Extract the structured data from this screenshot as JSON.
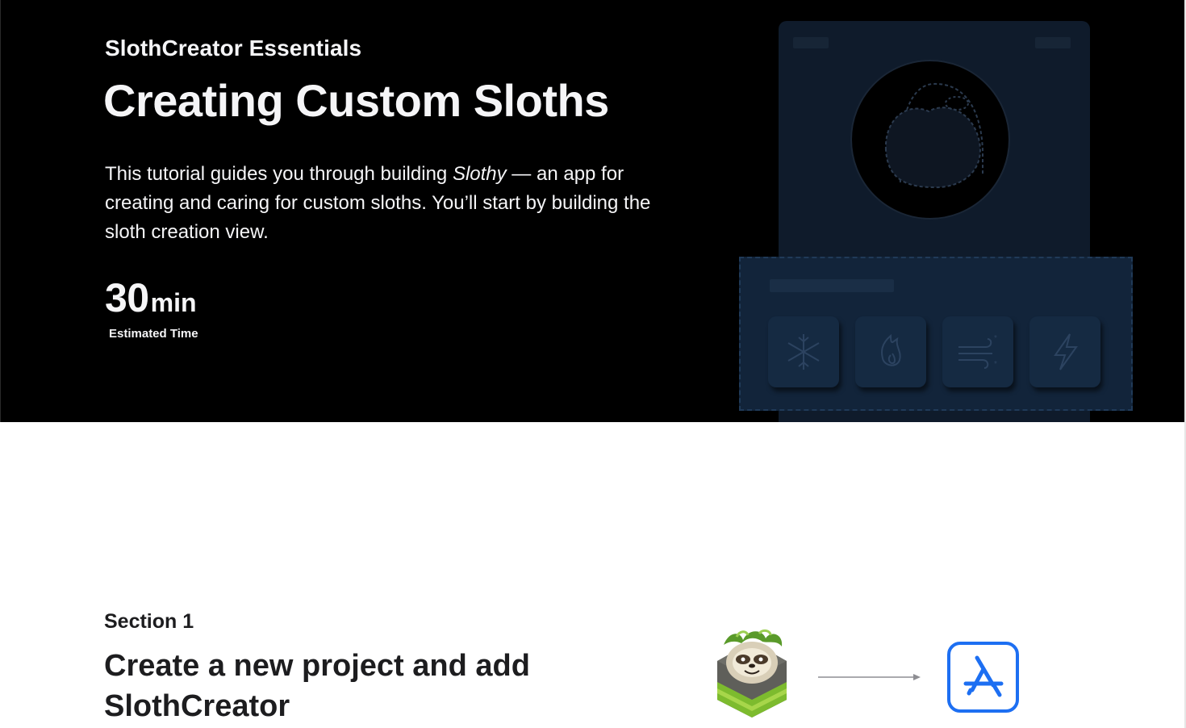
{
  "hero": {
    "eyebrow": "SlothCreator Essentials",
    "title": "Creating Custom Sloths",
    "description_prefix": "This tutorial guides you through building ",
    "description_emphasis": "Slothy",
    "description_suffix": " — an app for creating and caring for custom sloths. You’ll start by building the sloth creation view.",
    "duration_value": "30",
    "duration_unit": "min",
    "duration_label": "Estimated Time"
  },
  "illustration": {
    "power_icons": [
      "snowflake-icon",
      "flame-icon",
      "wind-icon",
      "lightning-icon"
    ]
  },
  "section": {
    "label": "Section 1",
    "title": "Create a new project and add SlothCreator"
  },
  "colors": {
    "hero_background": "#000000",
    "hero_text": "#f5f5f7",
    "accent_blue": "#1d6ff2",
    "body_text": "#1d1d1f"
  }
}
